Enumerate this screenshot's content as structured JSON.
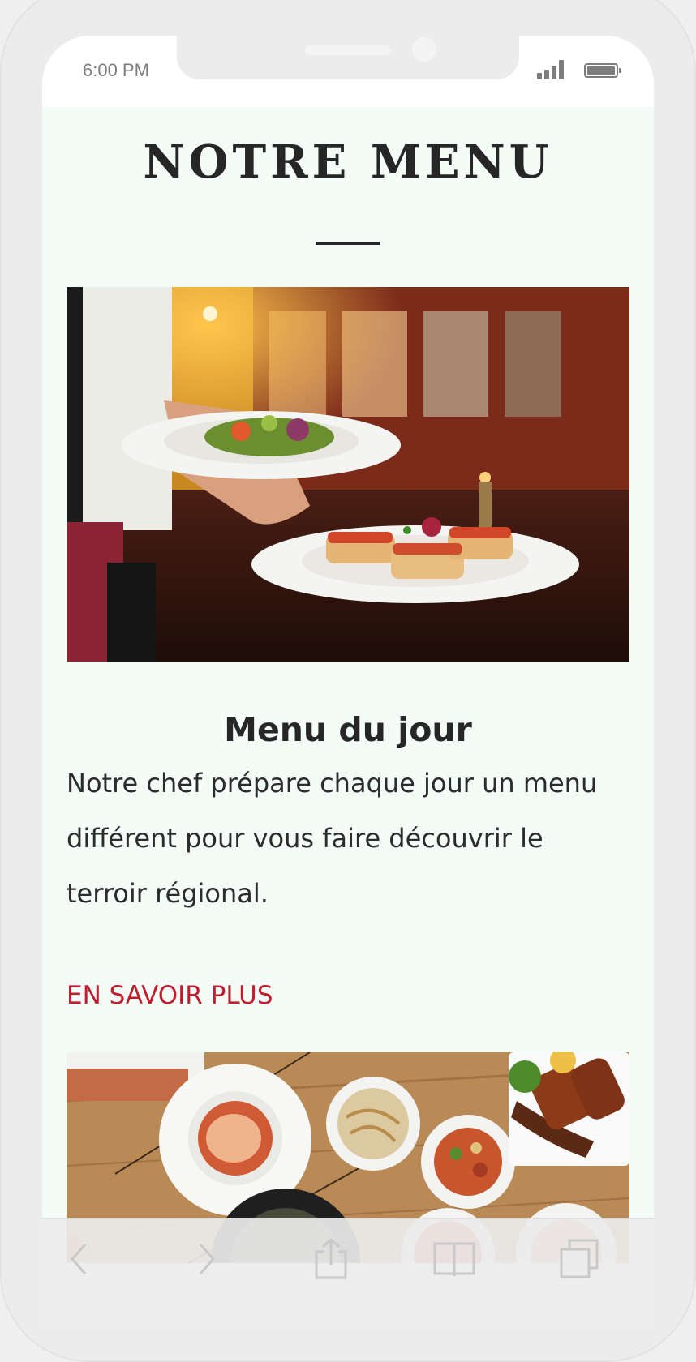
{
  "status_bar": {
    "time": "6:00 PM"
  },
  "menu": {
    "title": "NOTRE MENU",
    "section_title": "Menu du jour",
    "section_text": "Notre chef prépare chaque jour un menu différent pour vous faire découvrir le terroir régional.",
    "more_link": "EN SAVOIR PLUS"
  },
  "images": {
    "first": "waiter-serving-plates-photo",
    "second": "korean-dishes-table-photo"
  },
  "toolbar": {
    "back_icon": "chevron-left-icon",
    "forward_icon": "chevron-right-icon",
    "share_icon": "share-icon",
    "bookmarks_icon": "book-icon",
    "tabs_icon": "tabs-icon"
  },
  "colors": {
    "page_background": "#f4fcf8",
    "heading": "#262626",
    "link": "#c21d2c",
    "frame": "#ececec"
  }
}
